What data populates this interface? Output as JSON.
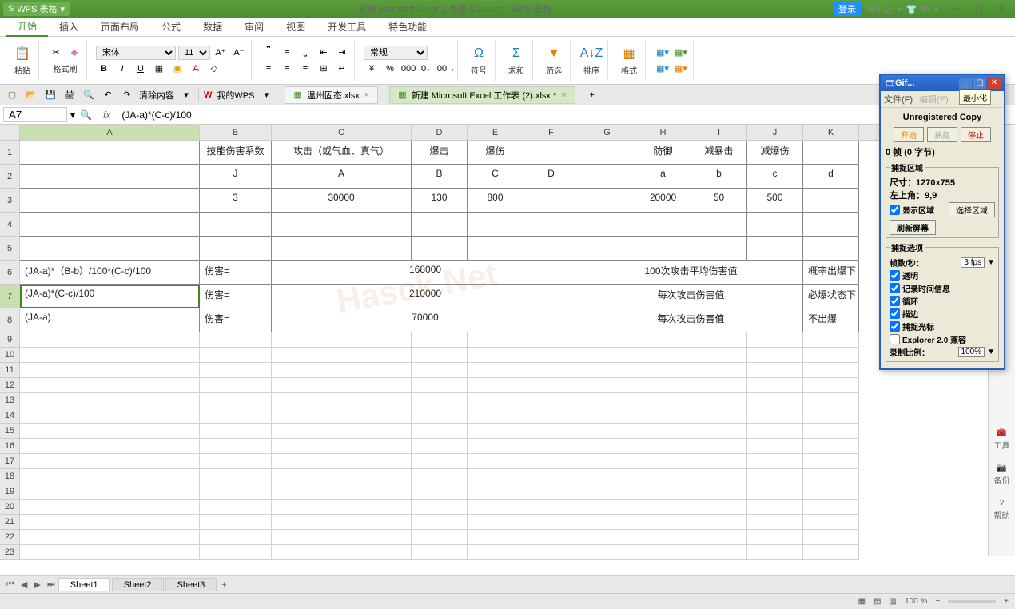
{
  "app": {
    "name": "WPS 表格",
    "doc_title": "新建 Microsoft Excel 工作表 (2).xlsx * - WPS 表格",
    "user": "马东正",
    "login_btn": "登录"
  },
  "tabs": [
    "开始",
    "插入",
    "页面布局",
    "公式",
    "数据",
    "审阅",
    "视图",
    "开发工具",
    "特色功能"
  ],
  "ribbon": {
    "paste": "粘贴",
    "format_painter": "格式刷",
    "font_name": "宋体",
    "font_size": "11",
    "bold": "B",
    "italic": "I",
    "underline": "U",
    "number_format": "常规",
    "cond_fmt": "符号",
    "sum": "求和",
    "filter": "筛选",
    "sort": "排序",
    "format": "格式"
  },
  "qat": {
    "clear": "清除内容",
    "my_wps": "我的WPS",
    "tab1": "温州固态.xlsx",
    "tab2": "新建 Microsoft Excel 工作表 (2).xlsx *"
  },
  "formula": {
    "cell_ref": "A7",
    "fx": "fx",
    "content": "(JA-a)*(C-c)/100"
  },
  "cols": {
    "A": 225,
    "B": 90,
    "C": 175,
    "D": 70,
    "E": 70,
    "F": 70,
    "G": 70,
    "H": 70,
    "I": 70,
    "J": 70,
    "K": 70
  },
  "sheet": {
    "row1": {
      "B": "技能伤害系数",
      "C": "攻击（或气血、真气）",
      "D": "爆击",
      "E": "爆伤",
      "H": "防御",
      "I": "减暴击",
      "J": "减爆伤"
    },
    "row2": {
      "B": "J",
      "C": "A",
      "D": "B",
      "E": "C",
      "F": "D",
      "H": "a",
      "I": "b",
      "J": "c",
      "K": "d"
    },
    "row3": {
      "B": "3",
      "C": "30000",
      "D": "130",
      "E": "800",
      "H": "20000",
      "I": "50",
      "J": "500"
    },
    "row6": {
      "A": "(JA-a)*（B-b）/100*(C-c)/100",
      "B": "伤害=",
      "D": "168000",
      "H": "100次攻击平均伤害值",
      "K": "概率出爆下"
    },
    "row7": {
      "A": "(JA-a)*(C-c)/100",
      "B": "伤害=",
      "D": "210000",
      "H": "每次攻击伤害值",
      "K": "必爆状态下"
    },
    "row8": {
      "A": "(JA-a)",
      "B": "伤害=",
      "D": "70000",
      "H": "每次攻击伤害值",
      "K": "不出爆"
    }
  },
  "sheets": [
    "Sheet1",
    "Sheet2",
    "Sheet3"
  ],
  "rpanel": {
    "tools": "工具",
    "backup": "备份",
    "help": "帮助"
  },
  "status": {
    "zoom": "100 %"
  },
  "gif": {
    "title": "Gif...",
    "menu_file": "文件(F)",
    "menu_edit": "编辑(E)",
    "tooltip": "最小化",
    "unreg": "Unregistered Copy",
    "start": "开始",
    "capture": "捕捉",
    "stop": "停止",
    "frames": "0 帧 (0 字节)",
    "area_title": "捕捉区域",
    "size": "尺寸：1270x755",
    "topleft": "左上角：9,9",
    "show_area": "显示区域",
    "select_area": "选择区域",
    "refresh": "刷新屏幕",
    "opt_title": "捕捉选项",
    "fps_label": "帧数/秒：",
    "fps": "3 fps",
    "transparent": "透明",
    "record_time": "记录时间信息",
    "loop": "循环",
    "border": "描边",
    "cursor": "捕捉光标",
    "explorer": "Explorer 2.0 兼容",
    "ratio_label": "录制比例：",
    "ratio": "100%"
  },
  "watermark": "Hasck.Net"
}
